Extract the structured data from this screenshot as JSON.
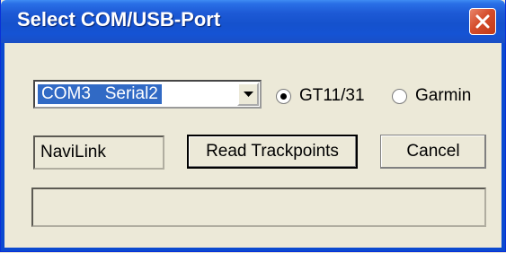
{
  "window": {
    "title": "Select COM/USB-Port"
  },
  "port_select": {
    "selected": "COM3   Serial2"
  },
  "device_type": {
    "options": [
      {
        "label": "GT11/31",
        "checked": true
      },
      {
        "label": "Garmin",
        "checked": false
      }
    ]
  },
  "status": {
    "device_name": "NaviLink"
  },
  "buttons": {
    "read_label": "Read Trackpoints",
    "cancel_label": "Cancel"
  },
  "progress": {
    "value": 0
  },
  "icons": {
    "close": "close-icon",
    "dropdown": "chevron-down-icon"
  },
  "colors": {
    "title_bar": "#1d5ad6",
    "selection": "#316ac5",
    "close_button": "#d54d2c"
  }
}
